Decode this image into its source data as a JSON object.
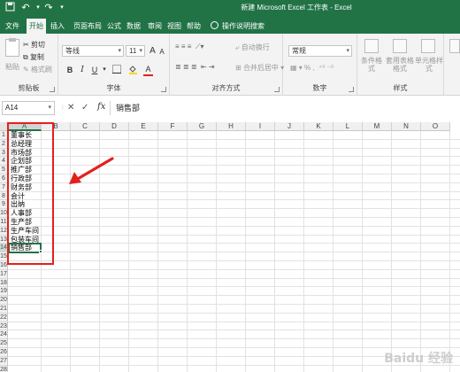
{
  "window": {
    "title": "新建 Microsoft Excel 工作表 - Excel",
    "accent_color": "#217346"
  },
  "tabs": [
    "文件",
    "开始",
    "插入",
    "页面布局",
    "公式",
    "数据",
    "审阅",
    "视图",
    "帮助"
  ],
  "active_tab": "开始",
  "tell_me": "操作说明搜索",
  "ribbon": {
    "clipboard": {
      "paste": "粘贴",
      "cut": "剪切",
      "copy": "复制",
      "format_painter": "格式刷",
      "label": "剪贴板"
    },
    "font": {
      "name": "等线",
      "size": "11",
      "grow": "A",
      "shrink": "A",
      "bold": "B",
      "italic": "I",
      "underline": "U",
      "font_color_letter": "A",
      "label": "字体",
      "font_color": "#e2211c"
    },
    "alignment": {
      "wrap": "自动换行",
      "merge": "合并后居中",
      "label": "对齐方式"
    },
    "number": {
      "format": "常规",
      "label": "数字"
    },
    "styles": {
      "conditional": "条件格式",
      "table": "套用表格格式",
      "cell": "单元格样式",
      "label": "样式"
    }
  },
  "formula_bar": {
    "name_box": "A14",
    "cancel": "✕",
    "enter": "✓",
    "fx": "fx",
    "formula": "销售部"
  },
  "columns": [
    "A",
    "B",
    "C",
    "D",
    "E",
    "F",
    "G",
    "H",
    "I",
    "J",
    "K",
    "L",
    "M",
    "N",
    "O"
  ],
  "selected_column": "A",
  "rows": [
    "1",
    "2",
    "3",
    "4",
    "5",
    "6",
    "7",
    "8",
    "9",
    "10",
    "11",
    "12",
    "13",
    "14",
    "15",
    "16",
    "17",
    "18",
    "19",
    "20",
    "21",
    "22",
    "23",
    "24",
    "25",
    "26",
    "27",
    "28"
  ],
  "selected_row": "14",
  "cells_a": [
    "董事长",
    "总经理",
    "市场部",
    "企划部",
    "推广部",
    "行政部",
    "财务部",
    "会计",
    "出纳",
    "人事部",
    "生产部",
    "生产车间",
    "包装车间",
    "销售部"
  ],
  "annotation_color": "#e2211c",
  "watermark": "Baidu 经验"
}
